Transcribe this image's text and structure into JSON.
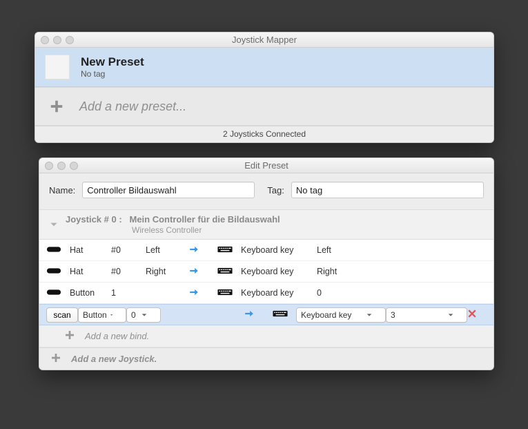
{
  "main_window": {
    "title": "Joystick Mapper",
    "preset": {
      "name": "New Preset",
      "tag": "No tag"
    },
    "add_preset_label": "Add a new preset...",
    "status": "2 Joysticks Connected"
  },
  "edit_window": {
    "title": "Edit Preset",
    "name_label": "Name:",
    "name_value": "Controller Bildauswahl",
    "tag_label": "Tag:",
    "tag_value": "No tag",
    "section": {
      "prefix": "Joystick #  0 :",
      "name": "Mein Controller für die Bildauswahl",
      "sub": "Wireless Controller"
    },
    "rows": [
      {
        "src_type": "Hat",
        "src_idx": "#0",
        "src_val": "Left",
        "out_type": "Keyboard key",
        "out_val": "Left"
      },
      {
        "src_type": "Hat",
        "src_idx": "#0",
        "src_val": "Right",
        "out_type": "Keyboard key",
        "out_val": "Right"
      },
      {
        "src_type": "Button",
        "src_idx": "1",
        "src_val": "",
        "out_type": "Keyboard key",
        "out_val": "0"
      }
    ],
    "edit_row": {
      "scan_label": "scan",
      "src_type": "Button",
      "src_idx": "0",
      "out_type": "Keyboard key",
      "out_val": "3"
    },
    "add_bind_label": "Add a new bind.",
    "add_joystick_label": "Add a new Joystick."
  }
}
